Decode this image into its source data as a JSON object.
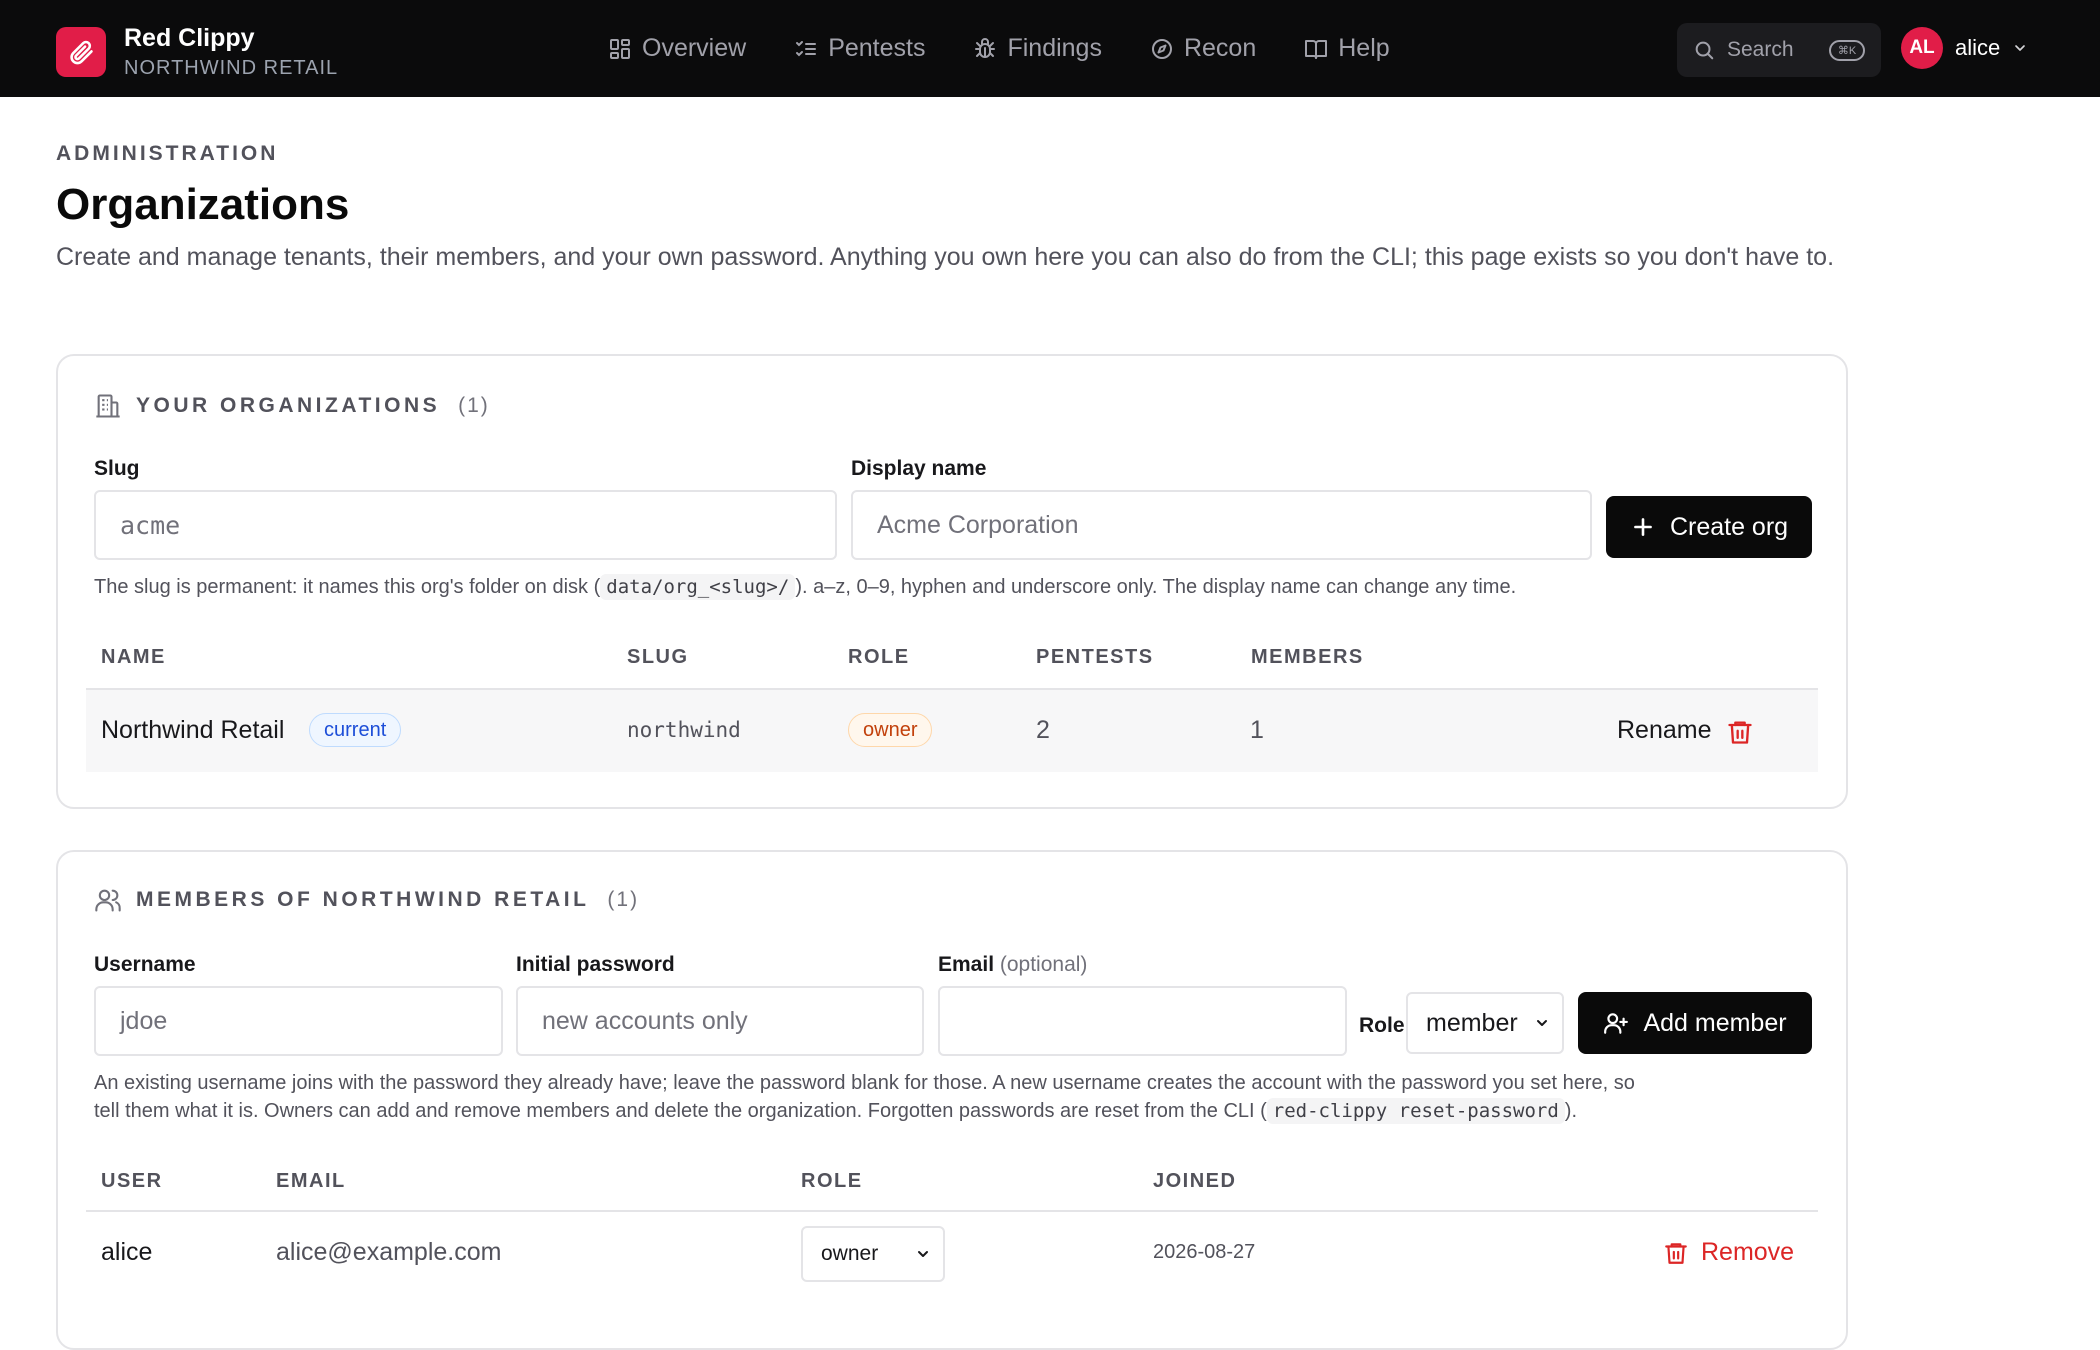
{
  "topbar": {
    "app_name": "Red Clippy",
    "org_name": "NORTHWIND RETAIL",
    "nav": [
      {
        "label": "Overview",
        "icon": "dashboard-icon"
      },
      {
        "label": "Pentests",
        "icon": "checklist-icon"
      },
      {
        "label": "Findings",
        "icon": "bug-icon"
      },
      {
        "label": "Recon",
        "icon": "compass-icon"
      },
      {
        "label": "Help",
        "icon": "book-icon"
      }
    ],
    "search_label": "Search",
    "search_shortcut": "⌘K",
    "user_initials": "AL",
    "user_name": "alice"
  },
  "header": {
    "eyebrow": "ADMINISTRATION",
    "title": "Organizations",
    "description": "Create and manage tenants, their members, and your own password. Anything you own here you can also do from the CLI; this page exists so you don't have to."
  },
  "orgs": {
    "title": "YOUR ORGANIZATIONS",
    "count": "(1)",
    "slug_label": "Slug",
    "slug_placeholder": "acme",
    "display_label": "Display name",
    "display_placeholder": "Acme Corporation",
    "create_label": "Create org",
    "help_before": "The slug is permanent: it names this org's folder on disk (",
    "help_code": "data/org_<slug>/",
    "help_after": "). a–z, 0–9, hyphen and underscore only. The display name can change any time.",
    "columns": [
      "NAME",
      "SLUG",
      "ROLE",
      "PENTESTS",
      "MEMBERS"
    ],
    "rows": [
      {
        "name": "Northwind Retail",
        "badge": "current",
        "slug": "northwind",
        "role": "owner",
        "pentests": "2",
        "members": "1",
        "rename_label": "Rename"
      }
    ]
  },
  "members": {
    "title": "MEMBERS OF NORTHWIND RETAIL",
    "count": "(1)",
    "username_label": "Username",
    "username_placeholder": "jdoe",
    "password_label": "Initial password",
    "password_placeholder": "new accounts only",
    "email_label": "Email",
    "email_optional": "(optional)",
    "role_label": "Role",
    "role_value": "member",
    "add_label": "Add member",
    "help_line1": "An existing username joins with the password they already have; leave the password blank for those. A new username creates the account with the password you set here, so",
    "help_line2_before": "tell them what it is. Owners can add and remove members and delete the organization. Forgotten passwords are reset from the CLI (",
    "help_code": "red-clippy reset-password",
    "help_line2_after": ").",
    "columns": [
      "USER",
      "EMAIL",
      "ROLE",
      "JOINED"
    ],
    "rows": [
      {
        "user": "alice",
        "email": "alice@example.com",
        "role": "owner",
        "joined": "2026-08-27",
        "remove_label": "Remove"
      }
    ]
  },
  "colors": {
    "brand": "#e11d48",
    "topbar_bg": "#0b0b0c",
    "danger": "#dc2626",
    "badge_blue": "#1d4ed8",
    "badge_orange": "#c2410c"
  }
}
